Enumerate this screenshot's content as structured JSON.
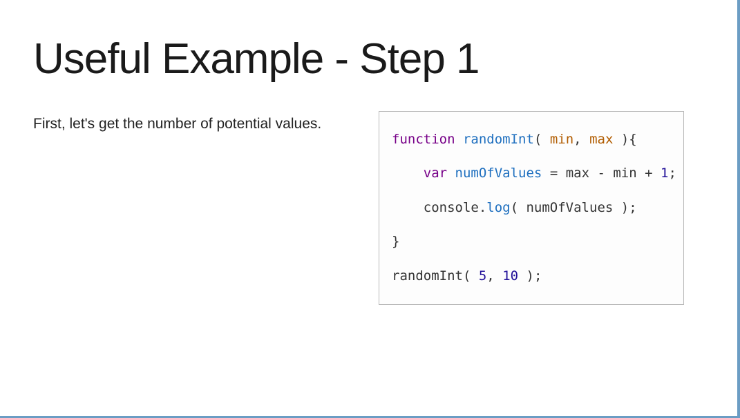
{
  "slide": {
    "title": "Useful Example - Step 1",
    "description": "First, let's get the number of potential values.",
    "code": {
      "l1_kw": "function",
      "l1_fn": "randomInt",
      "l1_open": "(",
      "l1_p1": "min",
      "l1_sep": ",",
      "l1_p2": "max",
      "l1_close": "){",
      "l2_kw": "var",
      "l2_var": "numOfValues",
      "l2_rest": " = max - min + ",
      "l2_num": "1",
      "l2_end": ";",
      "l3_pre": "    console.",
      "l3_method": "log",
      "l3_rest": "( numOfValues );",
      "l4": "}",
      "l5_pre": "randomInt( ",
      "l5_n1": "5",
      "l5_sep": ", ",
      "l5_n2": "10",
      "l5_end": " );"
    }
  }
}
